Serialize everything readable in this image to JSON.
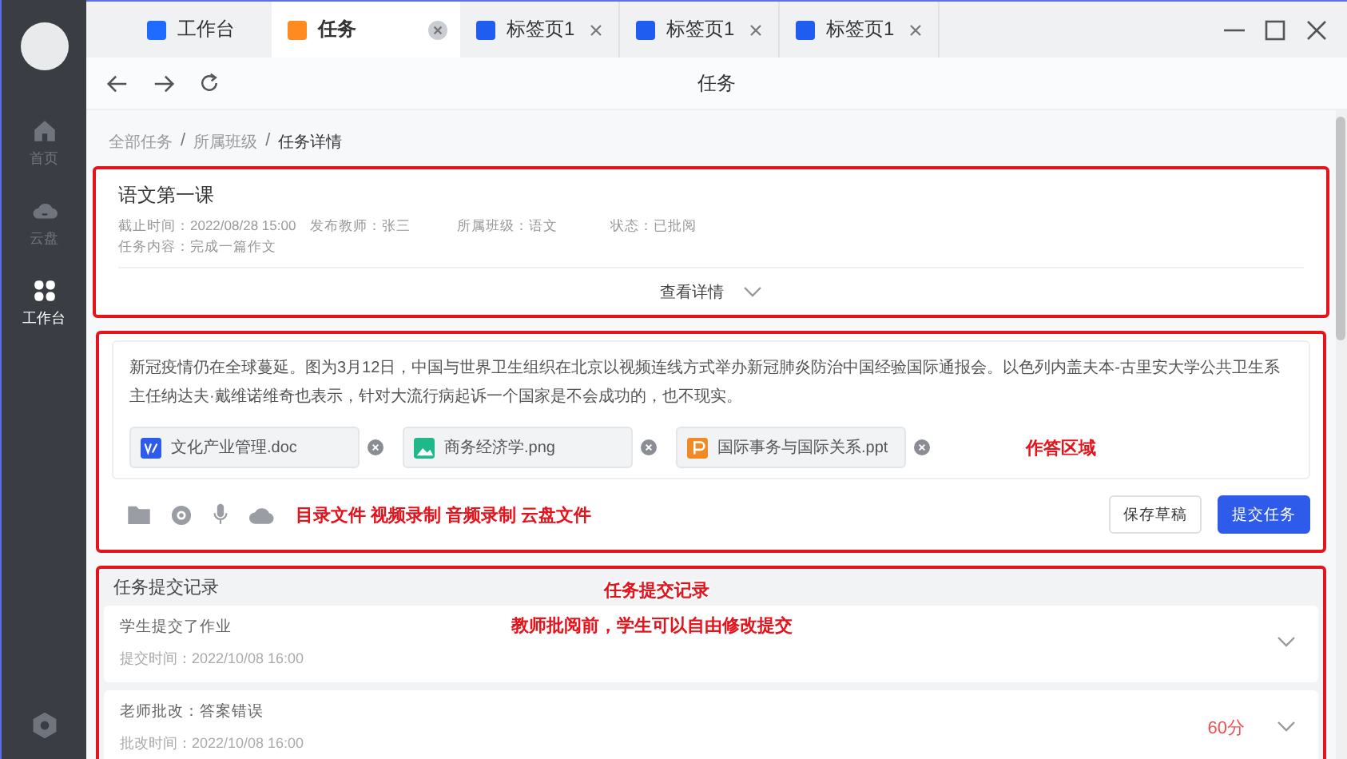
{
  "sidebar": {
    "items": [
      {
        "label": "首页",
        "selected": false
      },
      {
        "label": "云盘",
        "selected": false
      },
      {
        "label": "工作台",
        "selected": true
      }
    ]
  },
  "tabs": [
    {
      "label": "工作台",
      "color": "#1f6bff",
      "selected": false,
      "closable": false
    },
    {
      "label": "任务",
      "color": "#ff8a1f",
      "selected": true,
      "closable": true
    },
    {
      "label": "标签页1",
      "color": "#1f5cf0",
      "selected": false,
      "closable": true
    },
    {
      "label": "标签页1",
      "color": "#1f5cf0",
      "selected": false,
      "closable": true
    },
    {
      "label": "标签页1",
      "color": "#1f5cf0",
      "selected": false,
      "closable": true
    }
  ],
  "nav": {
    "title": "任务"
  },
  "breadcrumb": [
    {
      "label": "全部任务",
      "kind": "link",
      "current": false
    },
    {
      "label": "/",
      "kind": "separator",
      "current": false
    },
    {
      "label": "所属班级",
      "kind": "link",
      "current": false
    },
    {
      "label": "/",
      "kind": "separator",
      "current": false
    },
    {
      "label": "任务详情",
      "kind": "link",
      "current": true
    }
  ],
  "task": {
    "highlighted": true,
    "title": "语文第一课",
    "meta": [
      "截止时间：2022/08/28 15:00",
      "发布教师：张三",
      "所属班级：语文",
      "状态：已批阅"
    ],
    "content": "任务内容：完成一篇作文",
    "expand": "查看详情"
  },
  "answer": {
    "highlighted": true,
    "text": "新冠疫情仍在全球蔓延。图为3月12日，中国与世界卫生组织在北京以视频连线方式举办新冠肺炎防治中国经验国际通报会。以色列内盖夫本-古里安大学公共卫生系主任纳达夫·戴维诺维奇也表示，针对大流行病起诉一个国家是不会成功的，也不现实。",
    "files": [
      {
        "name": "文化产业管理.doc",
        "kind": "doc"
      },
      {
        "name": "商务经济学.png",
        "kind": "image"
      },
      {
        "name": "国际事务与国际关系.ppt",
        "kind": "ppt"
      }
    ],
    "note": "作答区域",
    "tools_note": "目录文件 视频录制 音频录制 云盘文件",
    "buttons": [
      {
        "label": "保存草稿",
        "primary": false
      },
      {
        "label": "提交任务",
        "primary": true
      }
    ]
  },
  "records": {
    "highlighted": true,
    "title": "任务提交记录",
    "notes": [
      "任务提交记录",
      "教师批阅前，学生可以自由修改提交"
    ],
    "items": [
      {
        "title": "学生提交了作业",
        "time": "提交时间：2022/10/08 16:00"
      },
      {
        "title": "老师批改：答案错误",
        "time": "批改时间：2022/10/08 16:00",
        "score": "60分"
      }
    ]
  }
}
